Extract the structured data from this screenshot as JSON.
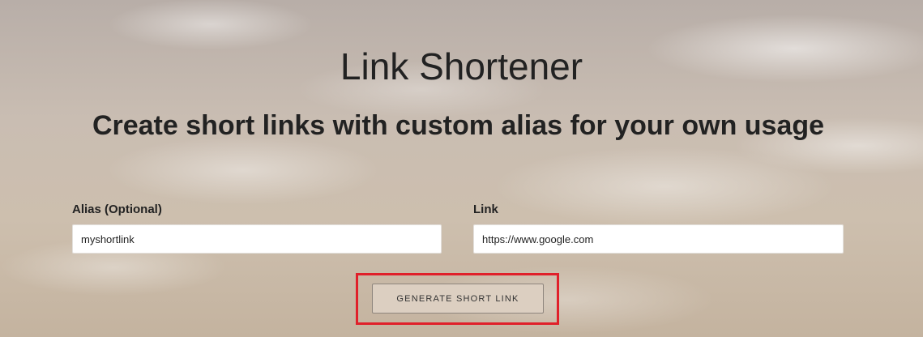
{
  "header": {
    "title": "Link Shortener",
    "subtitle": "Create short links with custom alias for your own usage"
  },
  "form": {
    "alias": {
      "label": "Alias (Optional)",
      "value": "myshortlink"
    },
    "link": {
      "label": "Link",
      "value": "https://www.google.com"
    },
    "submit_label": "GENERATE SHORT LINK"
  },
  "colors": {
    "highlight": "#e0202a",
    "text": "#222222",
    "button_bg": "#dccfc1"
  }
}
